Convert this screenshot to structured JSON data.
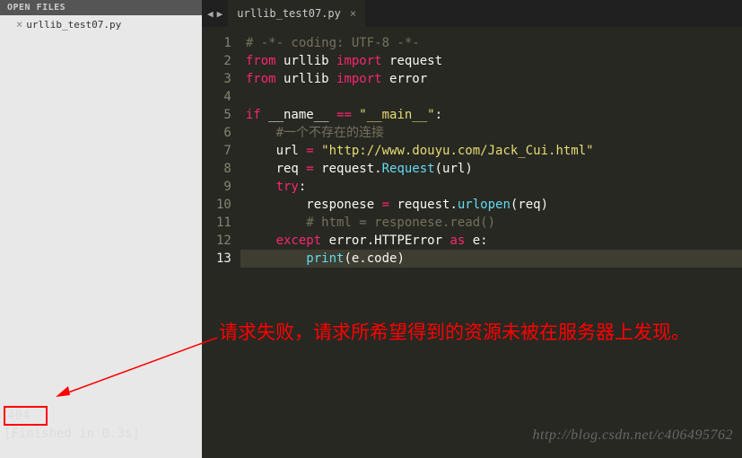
{
  "sidebar": {
    "header_label": "OPEN FILES",
    "file_name": "urllib_test07.py"
  },
  "tab": {
    "name": "urllib_test07.py",
    "close": "×"
  },
  "nav": {
    "prev": "◀",
    "next": "▶"
  },
  "gutter": [
    "1",
    "2",
    "3",
    "4",
    "5",
    "6",
    "7",
    "8",
    "9",
    "10",
    "11",
    "12",
    "13"
  ],
  "code": {
    "l1": "# -*- coding: UTF-8 -*-",
    "l2": {
      "from": "from",
      "mod1": " urllib ",
      "imp": "import",
      "mod2": " request"
    },
    "l3": {
      "from": "from",
      "mod1": " urllib ",
      "imp": "import",
      "mod2": " error"
    },
    "l5": {
      "if": "if",
      "name": " __name__ ",
      "eq": "==",
      "main": " \"__main__\"",
      "colon": ":"
    },
    "l6": "    #一个不存在的连接",
    "l7": {
      "pre": "    url ",
      "eq": "=",
      "str": " \"http://www.douyu.com/Jack_Cui.html\""
    },
    "l8": {
      "pre": "    req ",
      "eq": "=",
      "obj": " request.",
      "fn": "Request",
      "args": "(url)"
    },
    "l9": {
      "pre": "    ",
      "kw": "try",
      "colon": ":"
    },
    "l10": {
      "pre": "        responese ",
      "eq": "=",
      "obj": " request.",
      "fn": "urlopen",
      "args": "(req)"
    },
    "l11": "        # html = responese.read()",
    "l12": {
      "pre": "    ",
      "kw": "except",
      "obj": " error.HTTPError ",
      "as": "as",
      "var": " e",
      "colon": ":"
    },
    "l13": {
      "pre": "        ",
      "fn": "print",
      "args": "(e.code)"
    }
  },
  "console": {
    "output": "404",
    "finished": "[Finished in 0.3s]"
  },
  "annotation": "请求失败，请求所希望得到的资源未被在服务器上发现。",
  "watermark": "http://blog.csdn.net/c406495762"
}
